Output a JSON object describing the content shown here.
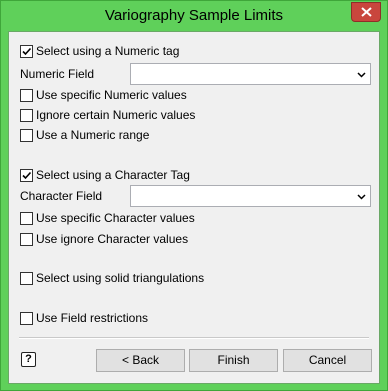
{
  "window": {
    "title": "Variography Sample Limits"
  },
  "numeric": {
    "select_tag": {
      "label": "Select using a Numeric tag",
      "checked": true
    },
    "field_label": "Numeric Field",
    "field_value": "",
    "specific_values": {
      "label": "Use specific Numeric values",
      "checked": false
    },
    "ignore_values": {
      "label": "Ignore certain Numeric values",
      "checked": false
    },
    "range": {
      "label": "Use a Numeric range",
      "checked": false
    }
  },
  "character": {
    "select_tag": {
      "label": "Select using a Character Tag",
      "checked": true
    },
    "field_label": "Character Field",
    "field_value": "",
    "specific_values": {
      "label": "Use specific Character values",
      "checked": false
    },
    "ignore_values": {
      "label": "Use ignore Character values",
      "checked": false
    }
  },
  "solid": {
    "label": "Select using solid triangulations",
    "checked": false
  },
  "field_restrictions": {
    "label": "Use Field restrictions",
    "checked": false
  },
  "buttons": {
    "back": "< Back",
    "finish": "Finish",
    "cancel": "Cancel",
    "help": "?"
  },
  "colors": {
    "titlebar": "#5fd05a",
    "close": "#c9463d",
    "client": "#f0f0f0"
  }
}
